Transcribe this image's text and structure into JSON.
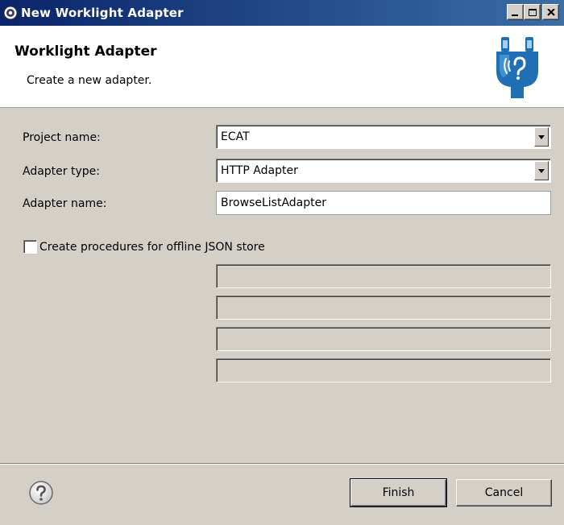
{
  "window": {
    "title": "New Worklight Adapter"
  },
  "header": {
    "title": "Worklight Adapter",
    "description": "Create a new adapter."
  },
  "form": {
    "project_label": "Project name:",
    "project_value": "ECAT",
    "adapter_type_label": "Adapter type:",
    "adapter_type_value": "HTTP Adapter",
    "adapter_name_label": "Adapter name:",
    "adapter_name_value": "BrowseListAdapter",
    "offline_checkbox_label": "Create procedures for offline JSON store",
    "offline_checkbox_checked": false
  },
  "footer": {
    "finish_label": "Finish",
    "cancel_label": "Cancel"
  },
  "icons": {
    "window": "eclipse-gear-icon",
    "banner": "adapter-plug-icon",
    "help": "help-icon"
  },
  "colors": {
    "titlebar_start": "#0a246a",
    "titlebar_end": "#3a6ea5",
    "dialog_bg": "#d4d0c8",
    "plug_blue": "#1f6fb4"
  }
}
